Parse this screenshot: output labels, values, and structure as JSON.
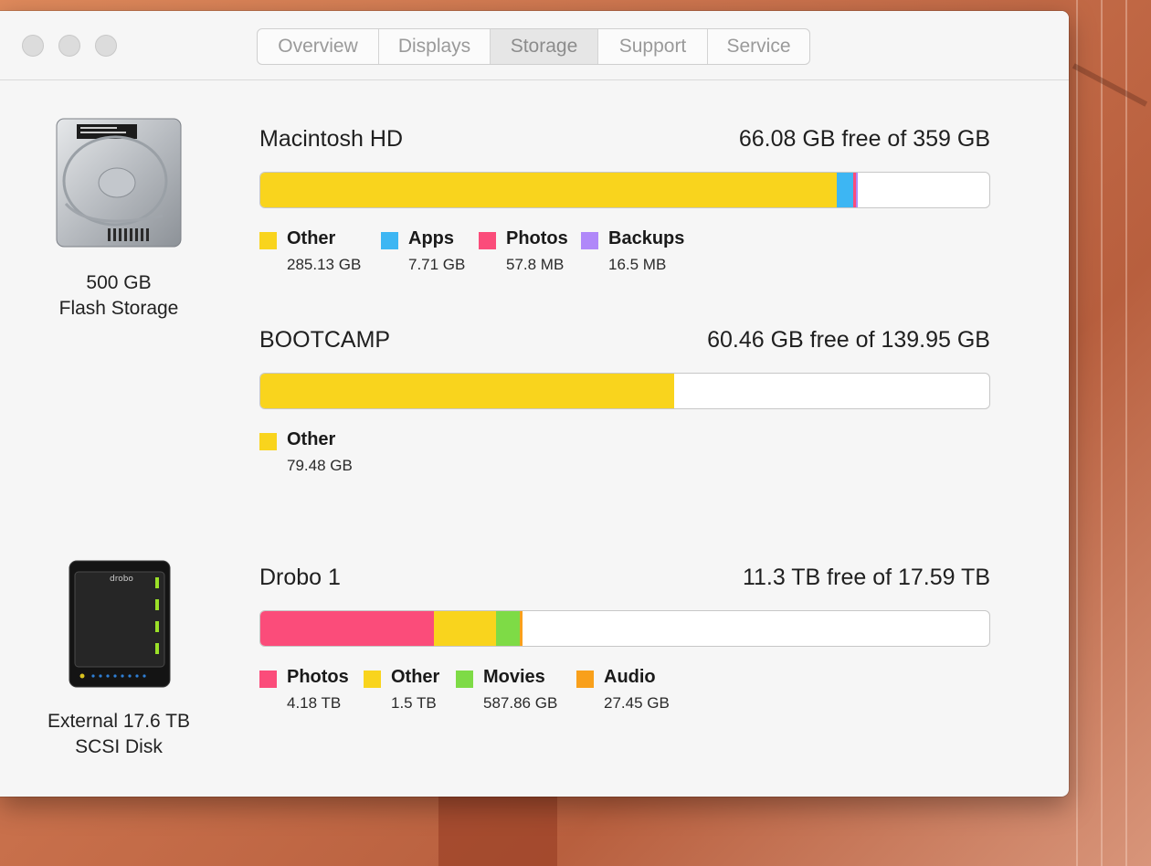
{
  "tabs": [
    {
      "label": "Overview",
      "active": false
    },
    {
      "label": "Displays",
      "active": false
    },
    {
      "label": "Storage",
      "active": true
    },
    {
      "label": "Support",
      "active": false
    },
    {
      "label": "Service",
      "active": false
    }
  ],
  "devices": [
    {
      "icon": "hard-drive-icon",
      "caption_line1": "500 GB",
      "caption_line2": "Flash Storage"
    },
    {
      "icon": "drobo-icon",
      "caption_line1": "External 17.6 TB",
      "caption_line2": "SCSI Disk"
    }
  ],
  "volumes": [
    {
      "name": "Macintosh HD",
      "free": "66.08 GB free of 359 GB",
      "usage_fractions": [
        0.791,
        0.022,
        0.0003,
        0.0008
      ],
      "legend": [
        {
          "label": "Other",
          "size": "285.13 GB",
          "color": "#f9d41d"
        },
        {
          "label": "Apps",
          "size": "7.71 GB",
          "color": "#3db6f3"
        },
        {
          "label": "Photos",
          "size": "57.8 MB",
          "color": "#fb4c7a"
        },
        {
          "label": "Backups",
          "size": "16.5 MB",
          "color": "#b088f9"
        }
      ]
    },
    {
      "name": "BOOTCAMP",
      "free": "60.46 GB free of 139.95 GB",
      "usage_fractions": [
        0.568
      ],
      "legend": [
        {
          "label": "Other",
          "size": "79.48 GB",
          "color": "#f9d41d"
        }
      ]
    },
    {
      "name": "Drobo 1",
      "free": "11.3 TB free of 17.59 TB",
      "usage_fractions": [
        0.238,
        0.085,
        0.0326,
        0.0016
      ],
      "legend": [
        {
          "label": "Photos",
          "size": "4.18 TB",
          "color": "#fb4c7a"
        },
        {
          "label": "Other",
          "size": "1.5 TB",
          "color": "#f9d41d"
        },
        {
          "label": "Movies",
          "size": "587.86 GB",
          "color": "#7edb46"
        },
        {
          "label": "Audio",
          "size": "27.45 GB",
          "color": "#f9a01b"
        }
      ]
    }
  ]
}
